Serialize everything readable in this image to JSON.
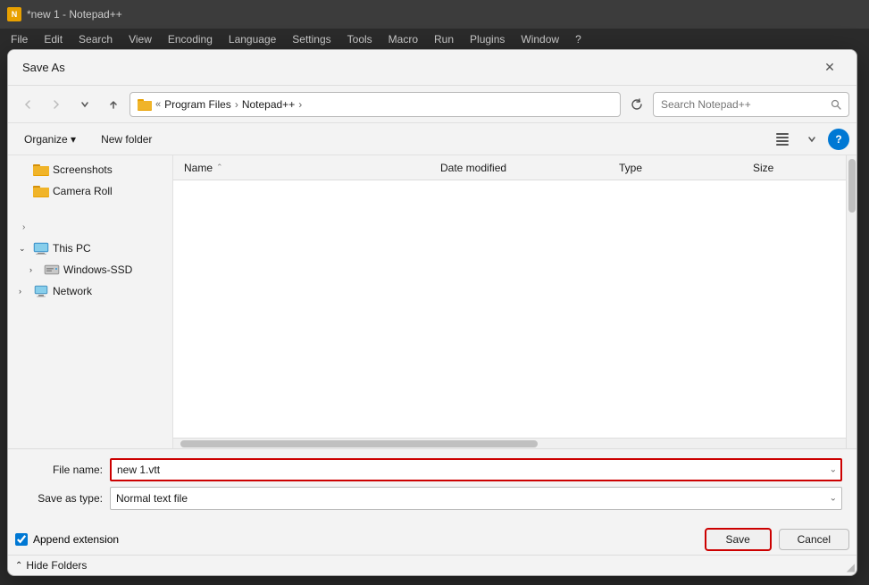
{
  "notepad": {
    "title": "*new 1 - Notepad++",
    "icon_label": "N",
    "menu_items": [
      "File",
      "Edit",
      "Search",
      "View",
      "Encoding",
      "Language",
      "Settings",
      "Tools",
      "Macro",
      "Run",
      "Plugins",
      "Window",
      "?"
    ]
  },
  "dialog": {
    "title": "Save As",
    "close_label": "✕"
  },
  "nav": {
    "back_label": "‹",
    "forward_label": "›",
    "dropdown_label": "⌄",
    "up_label": "↑",
    "breadcrumb": {
      "parts": [
        "« Program Files",
        "Notepad++"
      ],
      "separator": "›"
    },
    "refresh_label": "↻",
    "search_placeholder": "Search Notepad++",
    "search_icon": "🔍"
  },
  "toolbar": {
    "organize_label": "Organize ▾",
    "new_folder_label": "New folder",
    "view_icon": "☰",
    "view_dropdown_label": "▾",
    "help_label": "?"
  },
  "sidebar": {
    "items": [
      {
        "id": "screenshots",
        "label": "Screenshots",
        "icon": "folder",
        "indent": 0,
        "expanded": false,
        "arrow": ""
      },
      {
        "id": "camera-roll",
        "label": "Camera Roll",
        "icon": "folder",
        "indent": 0,
        "expanded": false,
        "arrow": ""
      },
      {
        "id": "spacer1",
        "label": "",
        "is_spacer": true
      },
      {
        "id": "expand-arrow",
        "label": "",
        "is_arrow": true,
        "arrow": "›",
        "indent": 0
      },
      {
        "id": "this-pc",
        "label": "This PC",
        "icon": "computer",
        "indent": 0,
        "expanded": true,
        "arrow": "⌄"
      },
      {
        "id": "windows-ssd",
        "label": "Windows-SSD",
        "icon": "drive",
        "indent": 1,
        "expanded": false,
        "arrow": "›"
      },
      {
        "id": "network",
        "label": "Network",
        "icon": "network",
        "indent": 0,
        "expanded": false,
        "arrow": "›"
      }
    ]
  },
  "file_list": {
    "columns": [
      {
        "id": "name",
        "label": "Name",
        "sort_arrow": "⌃"
      },
      {
        "id": "date",
        "label": "Date modified"
      },
      {
        "id": "type",
        "label": "Type"
      },
      {
        "id": "size",
        "label": "Size"
      }
    ],
    "rows": []
  },
  "form": {
    "filename_label": "File name:",
    "filename_value": "new 1.vtt",
    "savetype_label": "Save as type:",
    "savetype_value": "Normal text file",
    "savetype_arrow": "⌄",
    "filename_arrow": "⌄"
  },
  "footer": {
    "append_ext_label": "Append extension",
    "append_ext_checked": true,
    "save_label": "Save",
    "cancel_label": "Cancel",
    "hide_folders_label": "Hide Folders",
    "hide_arrow": "⌃"
  }
}
